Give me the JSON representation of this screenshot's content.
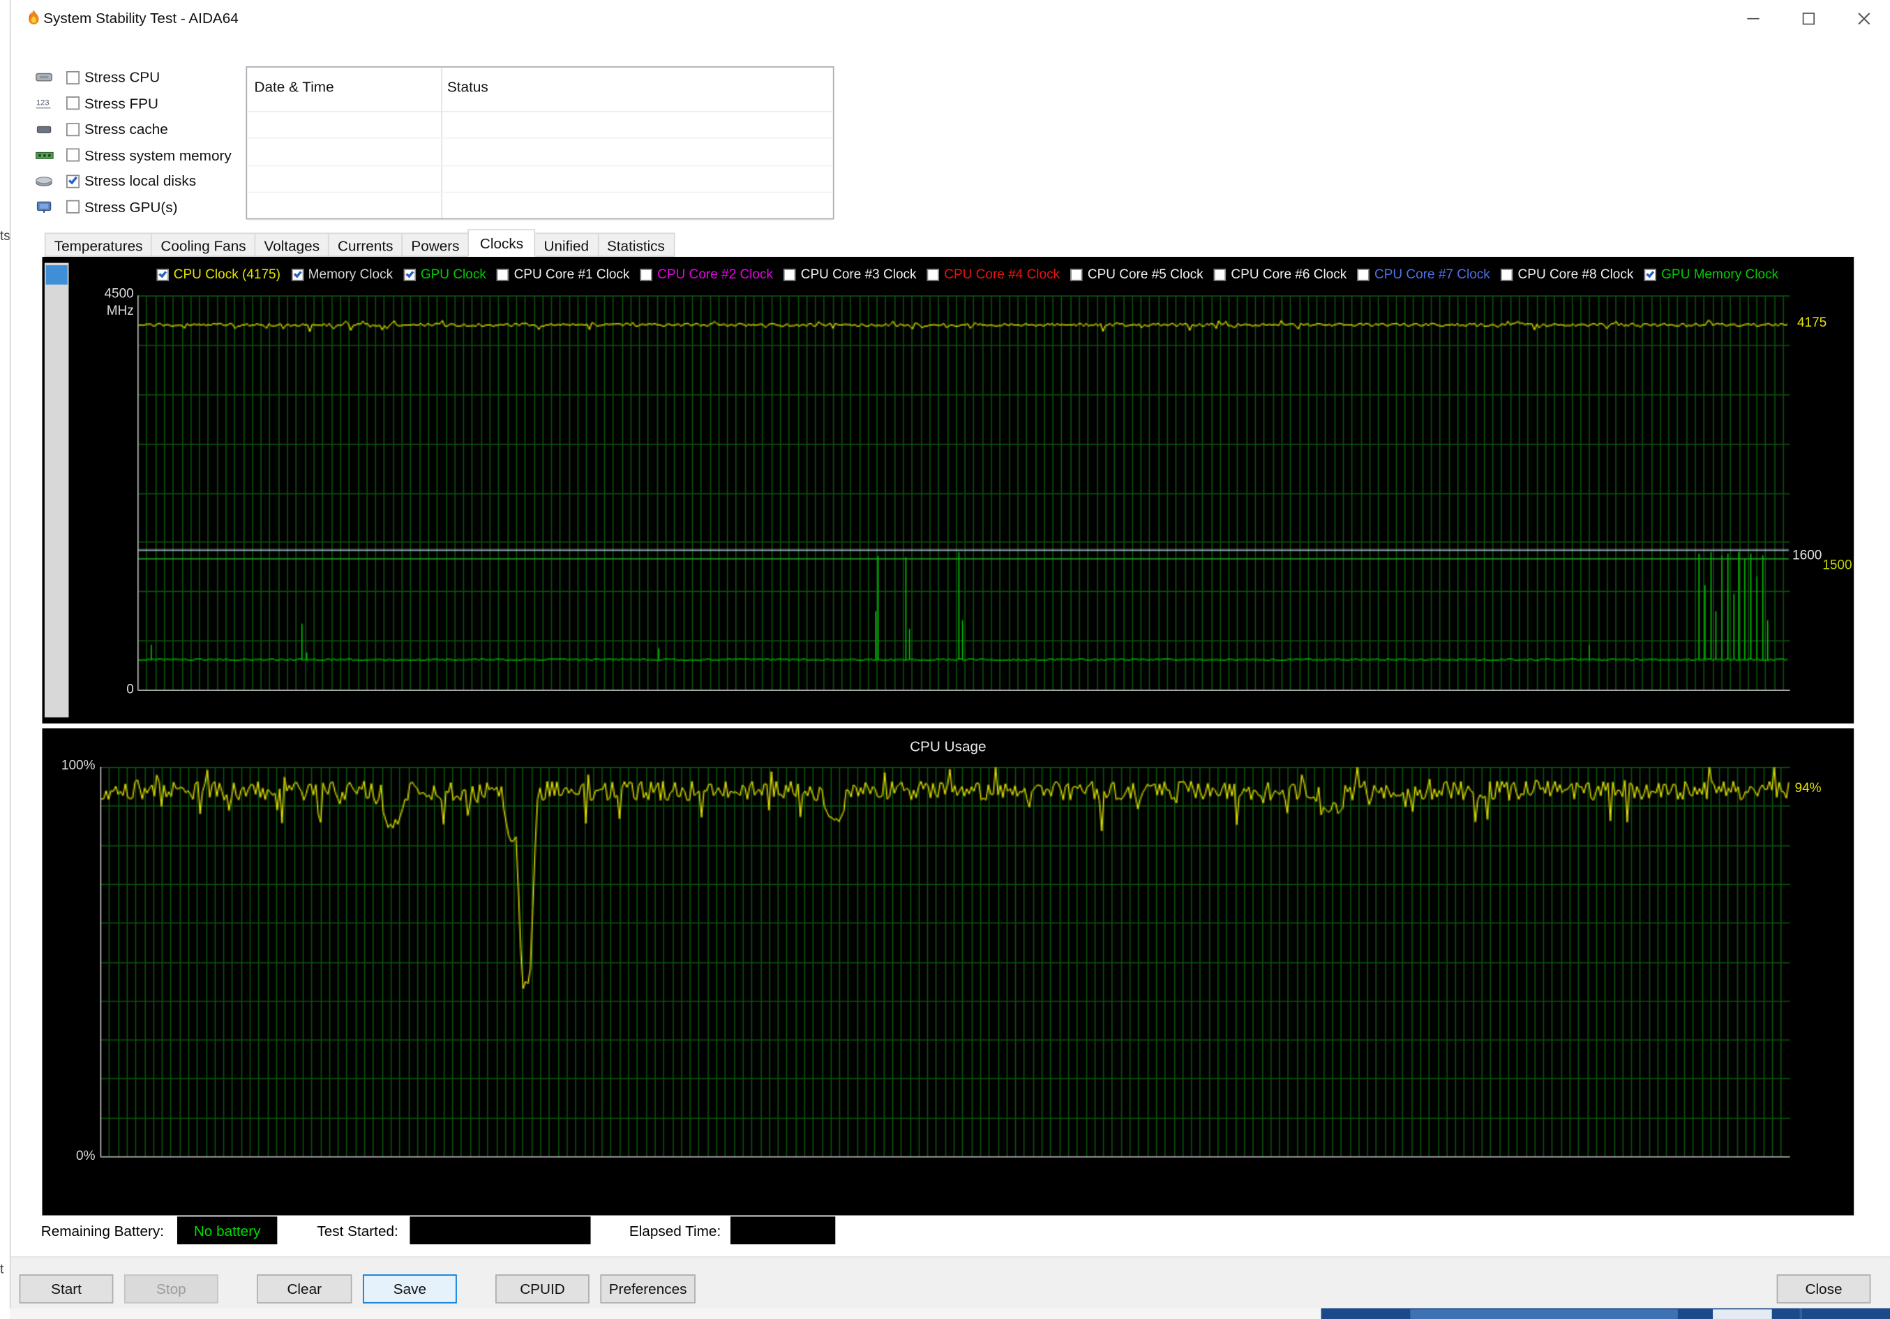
{
  "window": {
    "title": "System Stability Test - AIDA64"
  },
  "background_fragments": {
    "top": "ts",
    "bottom": "t"
  },
  "stress_options": [
    {
      "label": "Stress CPU",
      "icon": "cpu-icon",
      "checked": false
    },
    {
      "label": "Stress FPU",
      "icon": "fpu-icon",
      "checked": false
    },
    {
      "label": "Stress cache",
      "icon": "cache-icon",
      "checked": false
    },
    {
      "label": "Stress system memory",
      "icon": "memory-icon",
      "checked": false
    },
    {
      "label": "Stress local disks",
      "icon": "disk-icon",
      "checked": true
    },
    {
      "label": "Stress GPU(s)",
      "icon": "gpu-icon",
      "checked": false
    }
  ],
  "log_table": {
    "columns": [
      "Date & Time",
      "Status"
    ],
    "rows": []
  },
  "tabs": [
    {
      "label": "Temperatures",
      "selected": false
    },
    {
      "label": "Cooling Fans",
      "selected": false
    },
    {
      "label": "Voltages",
      "selected": false
    },
    {
      "label": "Currents",
      "selected": false
    },
    {
      "label": "Powers",
      "selected": false
    },
    {
      "label": "Clocks",
      "selected": true
    },
    {
      "label": "Unified",
      "selected": false
    },
    {
      "label": "Statistics",
      "selected": false
    }
  ],
  "legend": [
    {
      "label": "CPU Clock (4175)",
      "color": "#e3e300",
      "checked": true
    },
    {
      "label": "Memory Clock",
      "color": "#d6d6d6",
      "checked": true
    },
    {
      "label": "GPU Clock",
      "color": "#00cc00",
      "checked": true
    },
    {
      "label": "CPU Core #1 Clock",
      "color": "#f0f0f0",
      "checked": false
    },
    {
      "label": "CPU Core #2 Clock",
      "color": "#e800e8",
      "checked": false
    },
    {
      "label": "CPU Core #3 Clock",
      "color": "#f0f0f0",
      "checked": false
    },
    {
      "label": "CPU Core #4 Clock",
      "color": "#ee1111",
      "checked": false
    },
    {
      "label": "CPU Core #5 Clock",
      "color": "#f0f0f0",
      "checked": false
    },
    {
      "label": "CPU Core #6 Clock",
      "color": "#f0f0f0",
      "checked": false
    },
    {
      "label": "CPU Core #7 Clock",
      "color": "#4f6fe8",
      "checked": false
    },
    {
      "label": "CPU Core #8 Clock",
      "color": "#f0f0f0",
      "checked": false
    },
    {
      "label": "GPU Memory Clock",
      "color": "#00cc00",
      "checked": true
    }
  ],
  "chart_data": [
    {
      "type": "line",
      "title": "Clocks",
      "y_axis": {
        "max": 4500,
        "min": 0,
        "top_label": "4500",
        "unit_label": "MHz",
        "bottom_label": "0"
      },
      "grid": {
        "h_divisions": 8,
        "v_spacing_px": 7.3,
        "color": "#0b4f0b"
      },
      "right_labels": [
        {
          "text": "4175",
          "color": "#e3e300",
          "value": 4175
        },
        {
          "text": "1600",
          "color": "#e8e8e8",
          "value": 1600
        },
        {
          "text": "1500",
          "color": "#c3d400",
          "value": 1500
        }
      ],
      "series": [
        {
          "name": "Memory Clock",
          "color": "#c8d8e8",
          "kind": "flat",
          "value": 1600
        },
        {
          "name": "GPU Memory Clock",
          "color": "#1f9e1f",
          "kind": "flat",
          "value": 1500
        },
        {
          "name": "GPU Clock",
          "color": "#00bb00",
          "kind": "spiky",
          "base": 350,
          "amp": 9,
          "seed": 31,
          "spikes": [
            [
              0.008,
              520
            ],
            [
              0.099,
              760
            ],
            [
              0.102,
              430
            ],
            [
              0.315,
              480
            ],
            [
              0.448,
              1530
            ],
            [
              0.4465,
              900
            ],
            [
              0.4646,
              1520
            ],
            [
              0.467,
              700
            ],
            [
              0.497,
              1580
            ],
            [
              0.499,
              800
            ],
            [
              0.878,
              520
            ],
            [
              0.9445,
              1560
            ],
            [
              0.948,
              1200
            ],
            [
              0.9515,
              1580
            ],
            [
              0.955,
              900
            ],
            [
              0.9585,
              1540
            ],
            [
              0.962,
              1560
            ],
            [
              0.9655,
              1100
            ],
            [
              0.969,
              1580
            ],
            [
              0.9725,
              1500
            ],
            [
              0.976,
              1560
            ],
            [
              0.9795,
              1300
            ],
            [
              0.983,
              1540
            ],
            [
              0.9865,
              800
            ]
          ]
        },
        {
          "name": "CPU Clock",
          "color": "#e3e300",
          "kind": "noisy",
          "base": 4172,
          "amp": 18,
          "dip_chance": 0.08,
          "dip_depth": 70,
          "seed": 20
        }
      ]
    },
    {
      "type": "line",
      "title": "CPU Usage",
      "y_axis": {
        "max": 100,
        "min": 0,
        "top_label": "100%",
        "bottom_label": "0%"
      },
      "grid": {
        "h_divisions": 10,
        "v_spacing_px": 7.3,
        "color": "#0b4f0b"
      },
      "right_labels": [
        {
          "text": "94%",
          "color": "#e3e300",
          "value": 94
        }
      ],
      "series": [
        {
          "name": "CPU Usage",
          "color": "#e3e300",
          "kind": "noisy",
          "base": 94,
          "amp": 2.5,
          "dip_chance": 0.06,
          "dip_depth": 8,
          "seed": 5,
          "dips": [
            [
              0.173,
              84
            ],
            [
              0.245,
              80
            ],
            [
              0.252,
              43
            ],
            [
              0.435,
              86
            ],
            [
              0.73,
              88
            ]
          ]
        }
      ]
    }
  ],
  "status_bar": {
    "remaining_battery_label": "Remaining Battery:",
    "battery_value": "No battery",
    "battery_color": "#00dd00",
    "test_started_label": "Test Started:",
    "test_started_value": "",
    "elapsed_time_label": "Elapsed Time:",
    "elapsed_time_value": ""
  },
  "buttons": [
    {
      "label": "Start",
      "enabled": true,
      "default": false
    },
    {
      "label": "Stop",
      "enabled": false,
      "default": false
    },
    {
      "label": "Clear",
      "enabled": true,
      "default": false
    },
    {
      "label": "Save",
      "enabled": true,
      "default": true
    },
    {
      "label": "CPUID",
      "enabled": true,
      "default": false
    },
    {
      "label": "Preferences",
      "enabled": true,
      "default": false
    },
    {
      "label": "Close",
      "enabled": true,
      "default": false
    }
  ],
  "ui_colors": {
    "accent": "#0078d7",
    "chart_bg": "#000000",
    "grid_green": "#0b4f0b"
  }
}
